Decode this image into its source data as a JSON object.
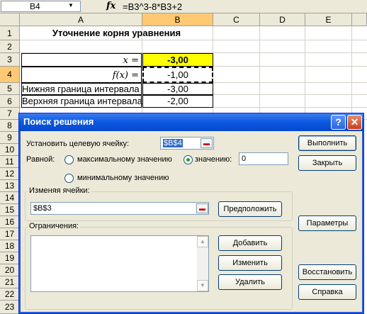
{
  "formula_bar": {
    "name_box": "B4",
    "fx": "fx",
    "formula": "=B3^3-8*B3+2"
  },
  "sheet": {
    "columns": [
      "A",
      "B",
      "C",
      "D",
      "E"
    ],
    "rows": [
      "1",
      "2",
      "3",
      "4",
      "5",
      "6",
      "7",
      "8",
      "9",
      "10",
      "11",
      "12",
      "13",
      "14",
      "15",
      "16",
      "17",
      "18",
      "19",
      "20",
      "21",
      "22",
      "23"
    ],
    "title": "Уточнение корня уравнения",
    "x_label": "x  =",
    "x_value": "-3,00",
    "fx_label": "f(x) =",
    "fx_value": "-1,00",
    "lower_label": "Нижняя граница интервала",
    "lower_value": "-3,00",
    "upper_label": "Верхняя граница интервала",
    "upper_value": "-2,00"
  },
  "dialog": {
    "title": "Поиск решения",
    "help_button": "?",
    "close_button": "✕",
    "target_label": "Установить целевую ячейку:",
    "target_value": "$B$4",
    "equal_label": "Равной:",
    "max_label": "максимальному значению",
    "value_label": "значению:",
    "value_input": "0",
    "min_label": "минимальному значению",
    "changing_label": "Изменяя ячейки:",
    "changing_value": "$B$3",
    "guess_button": "Предположить",
    "constraints_label": "Ограничения:",
    "add_button": "Добавить",
    "change_button": "Изменить",
    "delete_button": "Удалить",
    "solve_button": "Выполнить",
    "close_btn_label": "Закрыть",
    "options_button": "Параметры",
    "reset_button": "Восстановить",
    "help_btn_label": "Справка",
    "selected_radio": "value"
  }
}
